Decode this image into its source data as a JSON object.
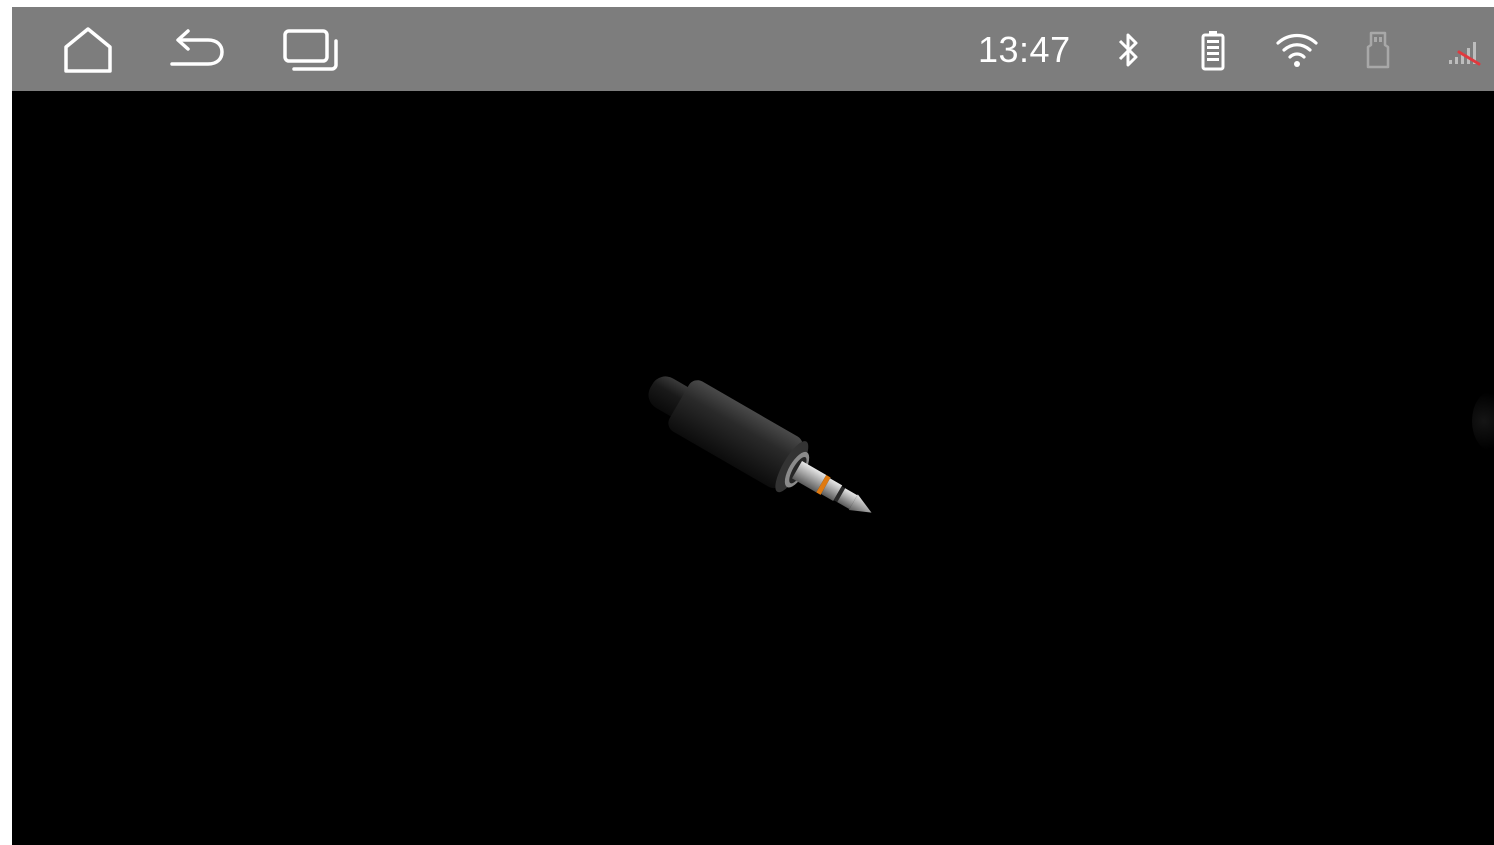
{
  "status_bar": {
    "clock": "13:47",
    "icons": {
      "home": "home-icon",
      "back": "back-icon",
      "recents": "recent-apps-icon",
      "bluetooth": "bluetooth-icon",
      "battery": "battery-icon",
      "wifi": "wifi-icon",
      "sd_card": "sd-card-icon",
      "signal": "cellular-signal-off-icon"
    },
    "colors": {
      "bar_background": "#7d7d7d",
      "icon": "#ffffff",
      "sd_card_dim": "#a8a8a8",
      "signal_off": "#e0393e"
    }
  },
  "main": {
    "graphic": "aux-audio-jack-plug",
    "background": "#000000",
    "accent_ring_color": "#e07a10"
  }
}
